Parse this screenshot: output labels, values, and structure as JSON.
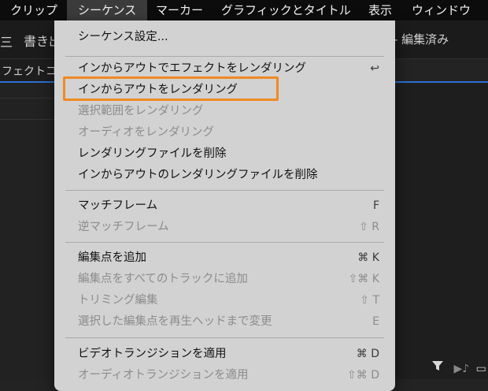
{
  "menubar": {
    "items": [
      "クリップ",
      "シーケンス",
      "マーカー",
      "グラフィックとタイトル",
      "表示",
      "ウィンドウ"
    ],
    "active": "シーケンス"
  },
  "background": {
    "tab_left": "書き出",
    "tab_right": "- 編集済み",
    "panel_left_label": "フェクトコ",
    "panel_icon_left": "三"
  },
  "menu": {
    "items": [
      {
        "label": "シーケンス設定...",
        "shortcut": "",
        "enabled": true
      },
      {
        "label": "インからアウトでエフェクトをレンダリング",
        "shortcut": "↩",
        "enabled": true
      },
      {
        "label": "インからアウトをレンダリング",
        "shortcut": "",
        "enabled": true,
        "highlighted": true
      },
      {
        "label": "選択範囲をレンダリング",
        "shortcut": "",
        "enabled": false
      },
      {
        "label": "オーディオをレンダリング",
        "shortcut": "",
        "enabled": false
      },
      {
        "label": "レンダリングファイルを削除",
        "shortcut": "",
        "enabled": true
      },
      {
        "label": "インからアウトのレンダリングファイルを削除",
        "shortcut": "",
        "enabled": true
      },
      {
        "label": "マッチフレーム",
        "shortcut": "F",
        "enabled": true
      },
      {
        "label": "逆マッチフレーム",
        "shortcut": "⇧ R",
        "enabled": false
      },
      {
        "label": "編集点を追加",
        "shortcut": "⌘ K",
        "enabled": true
      },
      {
        "label": "編集点をすべてのトラックに追加",
        "shortcut": "⇧⌘ K",
        "enabled": false
      },
      {
        "label": "トリミング編集",
        "shortcut": "⇧ T",
        "enabled": false
      },
      {
        "label": "選択した編集点を再生ヘッドまで変更",
        "shortcut": "E",
        "enabled": false
      },
      {
        "label": "ビデオトランジションを適用",
        "shortcut": "⌘ D",
        "enabled": true
      },
      {
        "label": "オーディオトランジションを適用",
        "shortcut": "⇧⌘ D",
        "enabled": false
      }
    ]
  },
  "colors": {
    "highlight_border": "#f08a24",
    "menu_bg": "#d2d2d2",
    "menubar_bg": "#0c0c0c"
  }
}
